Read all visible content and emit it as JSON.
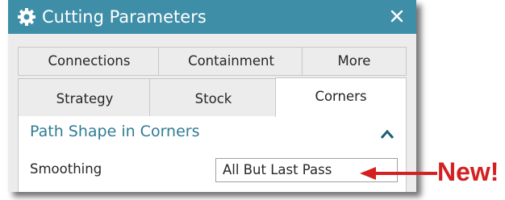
{
  "window": {
    "title": "Cutting Parameters",
    "close_symbol": "×",
    "title_icon": "gear-icon"
  },
  "tabs": {
    "row1": [
      {
        "label": "Connections",
        "active": false
      },
      {
        "label": "Containment",
        "active": false
      },
      {
        "label": "More",
        "active": false
      }
    ],
    "row2": [
      {
        "label": "Strategy",
        "active": false
      },
      {
        "label": "Stock",
        "active": false
      },
      {
        "label": "Corners",
        "active": true
      }
    ]
  },
  "section": {
    "title": "Path Shape in Corners",
    "collapse_icon": "chevron-up-icon"
  },
  "field": {
    "label": "Smoothing",
    "value": "All But Last Pass"
  },
  "callout": {
    "text": "New!"
  },
  "colors": {
    "titlebar": "#3f8ea7",
    "section_title": "#2f7c94",
    "callout": "#d42020",
    "dialog_bg": "#ececec"
  }
}
